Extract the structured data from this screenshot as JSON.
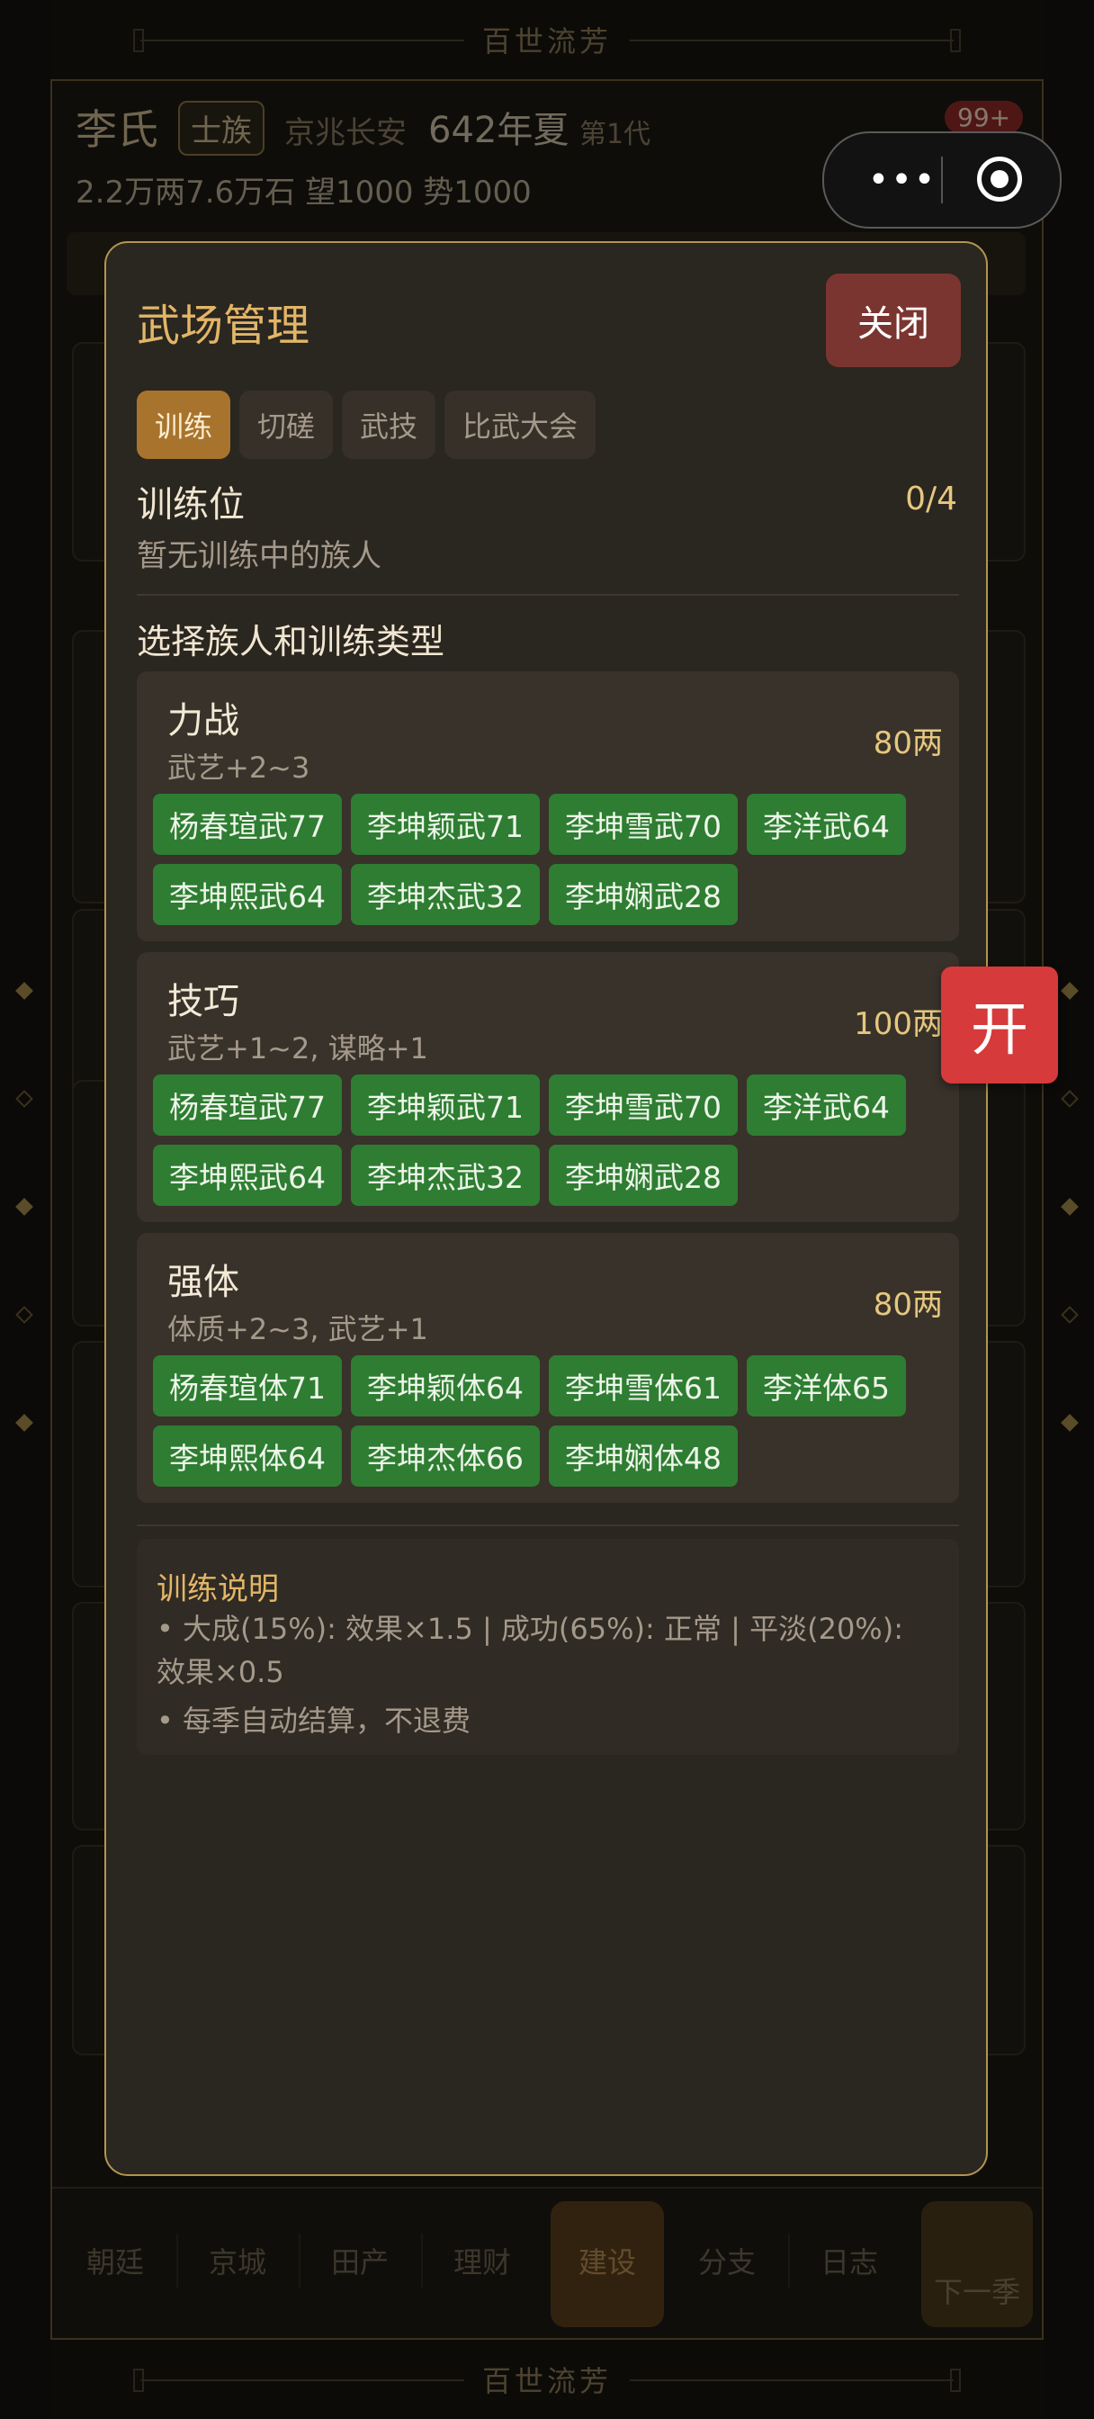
{
  "banner": {
    "title": "百世流芳"
  },
  "header": {
    "family": "李氏",
    "tag": "士族",
    "location": "京兆长安",
    "year": "642年夏",
    "generation": "第1代",
    "stats": "2.2万两7.6万石  望1000  势1000",
    "badge": "99+"
  },
  "nav": {
    "items": [
      "朝廷",
      "京城",
      "田产",
      "理财",
      "建设",
      "分支",
      "日志"
    ],
    "active": "建设",
    "next_label": "下一季"
  },
  "float_button": {
    "label": "开"
  },
  "modal": {
    "title": "武场管理",
    "close_label": "关闭",
    "tabs": [
      "训练",
      "切磋",
      "武技",
      "比武大会"
    ],
    "active_tab": "训练",
    "slots": {
      "title": "训练位",
      "count": "0/4",
      "empty": "暂无训练中的族人"
    },
    "select_title": "选择族人和训练类型",
    "training_types": [
      {
        "name": "力战",
        "effect": "武艺+2~3",
        "cost": "80两",
        "members": [
          "杨春瑄武77",
          "李坤颖武71",
          "李坤雪武70",
          "李洋武64",
          "李坤熙武64",
          "李坤杰武32",
          "李坤娴武28"
        ]
      },
      {
        "name": "技巧",
        "effect": "武艺+1~2, 谋略+1",
        "cost": "100两",
        "members": [
          "杨春瑄武77",
          "李坤颖武71",
          "李坤雪武70",
          "李洋武64",
          "李坤熙武64",
          "李坤杰武32",
          "李坤娴武28"
        ]
      },
      {
        "name": "强体",
        "effect": "体质+2~3, 武艺+1",
        "cost": "80两",
        "members": [
          "杨春瑄体71",
          "李坤颖体64",
          "李坤雪体61",
          "李洋体65",
          "李坤熙体64",
          "李坤杰体66",
          "李坤娴体48"
        ]
      }
    ],
    "notes": {
      "title": "训练说明",
      "lines": [
        "•  大成(15%): 效果×1.5 | 成功(65%): 正常 | 平淡(20%): 效果×0.5",
        "•  每季自动结算，不退费"
      ]
    }
  },
  "colors": {
    "accent": "#e2b667",
    "chip": "#2e7d32",
    "close": "#7b3530",
    "tab_active": "#a8742d",
    "float": "#d63a3a"
  }
}
